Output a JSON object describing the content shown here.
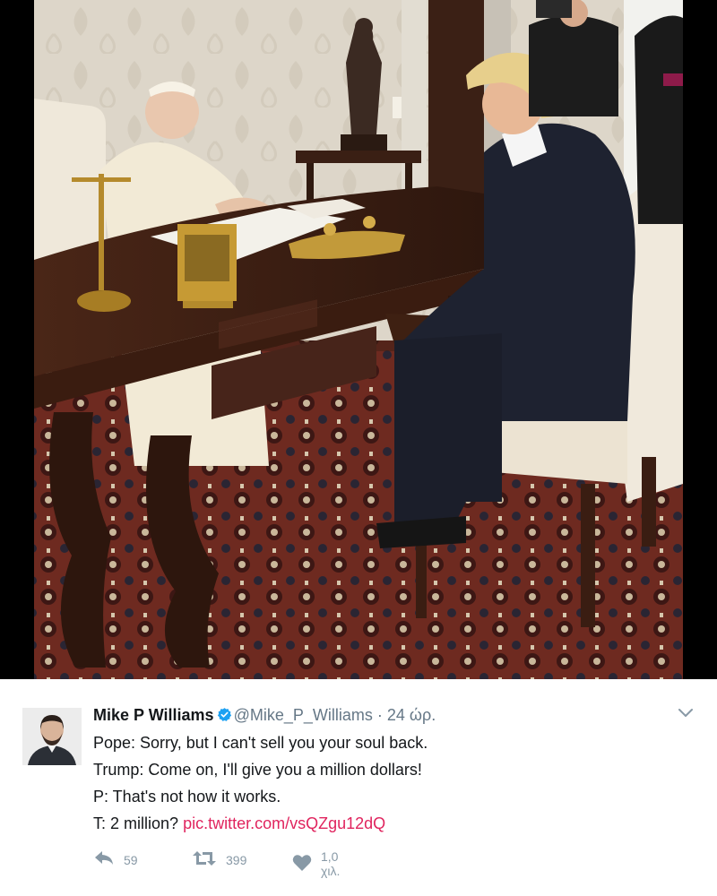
{
  "tweet": {
    "author_name": "Mike P Williams",
    "author_handle": "@Mike_P_Williams",
    "separator": "·",
    "timestamp": "24 ώρ.",
    "lines": [
      "Pope: Sorry, but I can't sell you your soul back.",
      "Trump: Come on, I'll give you a million dollars!",
      "P: That's not how it works."
    ],
    "last_line_text": "T: 2 million?",
    "link_text": "pic.twitter.com/vsQZgu12dQ",
    "replies": "59",
    "retweets": "399",
    "likes": "1,0 χιλ."
  },
  "colors": {
    "link": "#e0245e",
    "verified": "#1da1f2",
    "muted": "#657786",
    "action_icon": "#8899a6"
  },
  "icons": [
    "verified-badge-icon",
    "chevron-down-icon",
    "reply-icon",
    "retweet-icon",
    "heart-icon"
  ]
}
